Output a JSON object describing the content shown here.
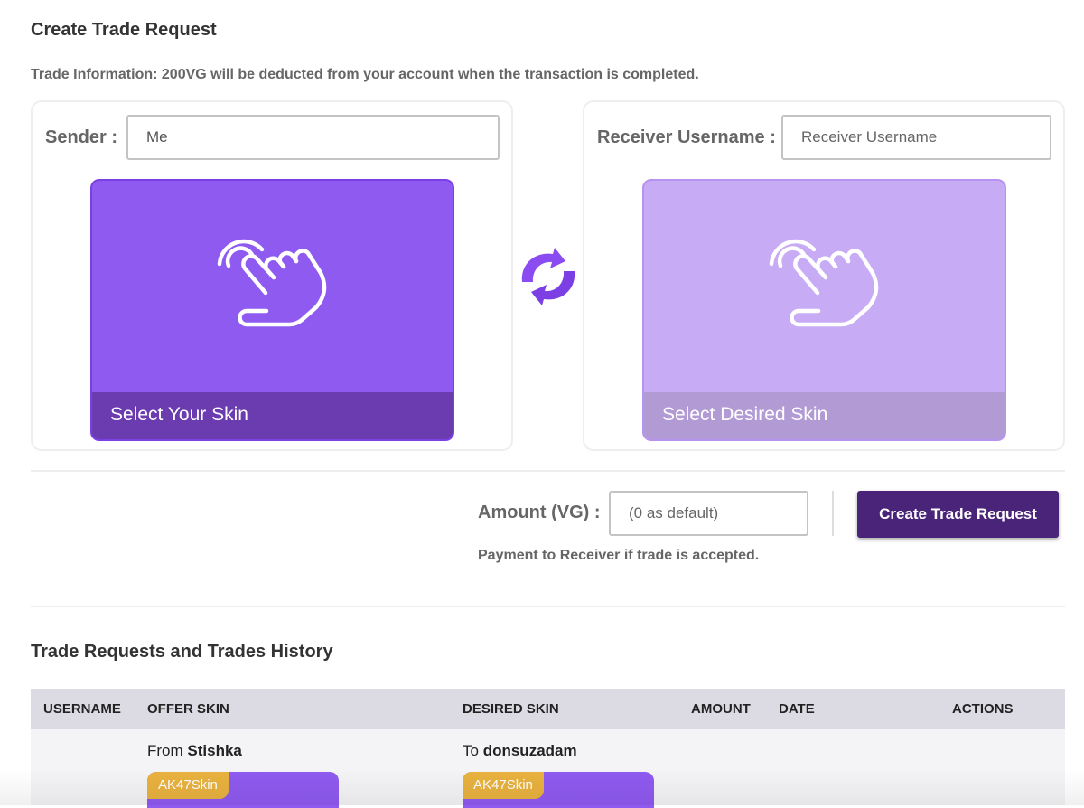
{
  "page": {
    "title": "Create Trade Request",
    "info": "Trade Information: 200VG will be deducted from your account when the transaction is completed."
  },
  "sender": {
    "label": "Sender :",
    "value": "Me",
    "card_label": "Select Your Skin",
    "card_icon": "hand-tap-icon"
  },
  "receiver": {
    "label": "Receiver Username :",
    "placeholder": "Receiver Username",
    "card_label": "Select Desired Skin",
    "card_icon": "hand-tap-icon"
  },
  "swap_icon": "swap-arrows-icon",
  "amount": {
    "label": "Amount (VG) :",
    "placeholder": "(0 as default)",
    "note": "Payment to Receiver if trade is accepted."
  },
  "create_button": "Create Trade Request",
  "history": {
    "title": "Trade Requests and Trades History",
    "columns": [
      "USERNAME",
      "OFFER SKIN",
      "DESIRED SKIN",
      "AMOUNT",
      "DATE",
      "ACTIONS"
    ],
    "rows": [
      {
        "offer_prefix": "From",
        "offer_user": "Stishka",
        "offer_skin_tag": "AK47Skin",
        "desired_prefix": "To",
        "desired_user": "donsuzadam",
        "desired_skin_tag": "AK47Skin"
      }
    ]
  },
  "colors": {
    "primary_purple": "#8f5af0",
    "light_purple": "#c8abf5",
    "button_purple": "#4a2478",
    "tag_orange": "#e9b23f"
  }
}
